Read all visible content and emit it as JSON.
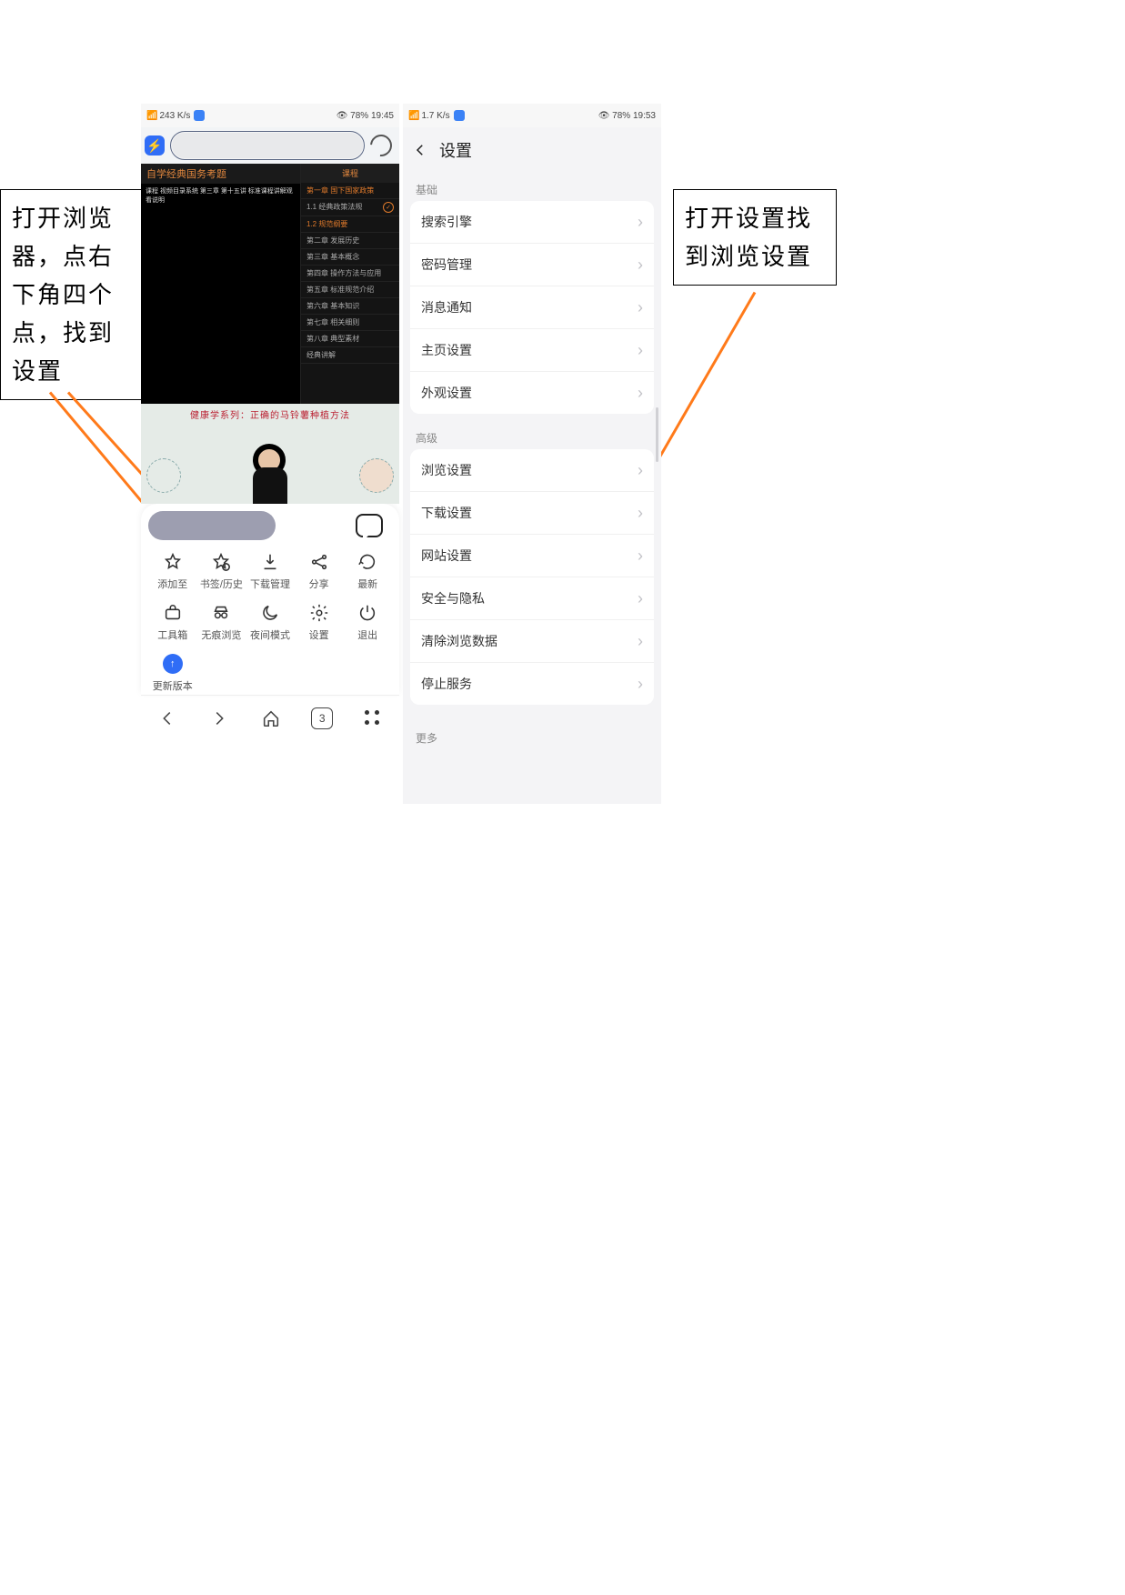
{
  "annotations": {
    "left": "打开浏览器，点右下角四个点，找到设置",
    "right": "打开设置找到浏览设置"
  },
  "phone1": {
    "status": {
      "left": "243 K/s",
      "right": "78%  19:45",
      "net_icon": "signal-icon"
    },
    "page": {
      "banner": "自学经典国务考题",
      "subline": "课程 视频目录系统 第三章 第十五讲 标准课程讲解观看说明",
      "menu_header": "课程",
      "menu": [
        {
          "label": "第一章  国下国家政策",
          "accent": true,
          "tick": false
        },
        {
          "label": "1.1 经典政策法规",
          "accent": false,
          "tick": true
        },
        {
          "label": "1.2 规范纲要",
          "accent": true,
          "tick": false
        },
        {
          "label": "第二章 发展历史",
          "accent": false,
          "tick": false
        },
        {
          "label": "第三章 基本概念",
          "accent": false,
          "tick": false
        },
        {
          "label": "第四章 操作方法与应用",
          "accent": false,
          "tick": false
        },
        {
          "label": "第五章 标准规范介绍",
          "accent": false,
          "tick": false
        },
        {
          "label": "第六章 基本知识",
          "accent": false,
          "tick": false
        },
        {
          "label": "第七章 相关细则",
          "accent": false,
          "tick": false
        },
        {
          "label": "第八章 典型素材",
          "accent": false,
          "tick": false
        },
        {
          "label": "经典讲解",
          "accent": false,
          "tick": false
        }
      ],
      "video_title": "健康学系列：正确的马铃薯种植方法"
    },
    "sheet": {
      "row1": [
        {
          "icon": "star-outline-icon",
          "label": "添加至"
        },
        {
          "icon": "star-clock-icon",
          "label": "书签/历史"
        },
        {
          "icon": "download-icon",
          "label": "下载管理"
        },
        {
          "icon": "share-icon",
          "label": "分享"
        },
        {
          "icon": "refresh-icon",
          "label": "最新"
        }
      ],
      "row2": [
        {
          "icon": "toolbox-icon",
          "label": "工具箱"
        },
        {
          "icon": "incognito-icon",
          "label": "无痕浏览"
        },
        {
          "icon": "moon-icon",
          "label": "夜间模式"
        },
        {
          "icon": "gear-icon",
          "label": "设置"
        },
        {
          "icon": "power-icon",
          "label": "退出"
        }
      ],
      "row3": [
        {
          "icon": "upload-round-icon",
          "label": "更新版本"
        }
      ]
    },
    "bottom_nav": {
      "back": "back-icon",
      "forward": "forward-icon",
      "home": "home-icon",
      "tabs": "3",
      "menu": "four-dots-icon"
    }
  },
  "phone2": {
    "status": {
      "left": "1.7 K/s",
      "right": "78%  19:53"
    },
    "header": "设置",
    "basic_title": "基础",
    "basic": [
      "搜索引擎",
      "密码管理",
      "消息通知",
      "主页设置",
      "外观设置"
    ],
    "adv_title": "高级",
    "adv": [
      "浏览设置",
      "下载设置",
      "网站设置",
      "安全与隐私",
      "清除浏览数据",
      "停止服务"
    ],
    "more": "更多"
  }
}
